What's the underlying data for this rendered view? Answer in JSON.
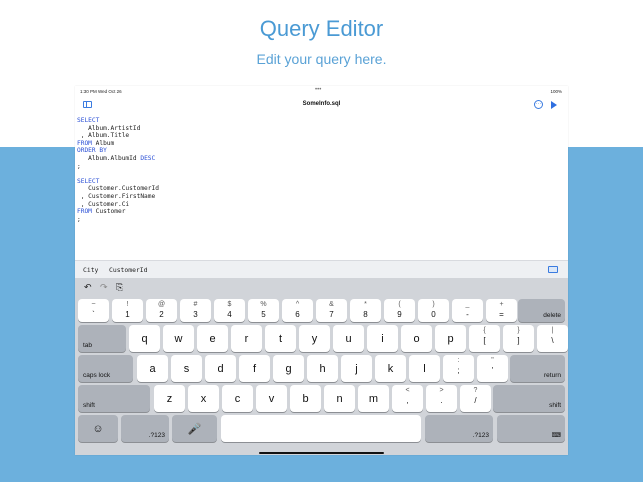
{
  "marketing": {
    "headline": "Query Editor",
    "subline": "Edit your query here."
  },
  "status_bar": {
    "time": "1:30 PM   Wed Oct 26",
    "dots": "•••",
    "battery": "100%"
  },
  "nav": {
    "title": "SomeInfo.sql",
    "sidebar_icon": "sidebar-icon",
    "more_icon": "ellipsis-circle-icon",
    "run_icon": "play-icon",
    "more_glyph": "···"
  },
  "editor": {
    "lines": [
      "SELECT",
      "   Album.ArtistId",
      " , Album.Title",
      "FROM Album",
      "ORDER BY",
      "   Album.AlbumId DESC",
      ";",
      "",
      "SELECT",
      "   Customer.CustomerId",
      " , Customer.FirstName",
      " , Customer.Ci",
      "FROM Customer",
      ";"
    ],
    "accent_color": "#2a4fd6"
  },
  "suggestions": {
    "items": [
      "City",
      "CustomerId"
    ]
  },
  "keyboard": {
    "toolbar": {
      "undo": "↶",
      "redo": "↷",
      "paste": "⎘"
    },
    "row1": [
      {
        "top": "~",
        "bot": "`"
      },
      {
        "top": "!",
        "bot": "1"
      },
      {
        "top": "@",
        "bot": "2"
      },
      {
        "top": "#",
        "bot": "3"
      },
      {
        "top": "$",
        "bot": "4"
      },
      {
        "top": "%",
        "bot": "5"
      },
      {
        "top": "^",
        "bot": "6"
      },
      {
        "top": "&",
        "bot": "7"
      },
      {
        "top": "*",
        "bot": "8"
      },
      {
        "top": "(",
        "bot": "9"
      },
      {
        "top": ")",
        "bot": "0"
      },
      {
        "top": "_",
        "bot": "-"
      },
      {
        "top": "+",
        "bot": "="
      }
    ],
    "delete": "delete",
    "tab": "tab",
    "row2": [
      "q",
      "w",
      "e",
      "r",
      "t",
      "y",
      "u",
      "i",
      "o",
      "p"
    ],
    "row2_extra": [
      {
        "top": "{",
        "bot": "["
      },
      {
        "top": "}",
        "bot": "]"
      },
      {
        "top": "|",
        "bot": "\\"
      }
    ],
    "caps_lock": "caps lock",
    "row3": [
      "a",
      "s",
      "d",
      "f",
      "g",
      "h",
      "j",
      "k",
      "l"
    ],
    "row3_extra": [
      {
        "top": ":",
        "bot": ";"
      },
      {
        "top": "\"",
        "bot": "'"
      }
    ],
    "return": "return",
    "shift_left": "shift",
    "row4": [
      "z",
      "x",
      "c",
      "v",
      "b",
      "n",
      "m"
    ],
    "row4_extra": [
      {
        "top": "<",
        "bot": ","
      },
      {
        "top": ">",
        "bot": "."
      },
      {
        "top": "?",
        "bot": "/"
      }
    ],
    "shift_right": "shift",
    "emoji": "☺",
    "numbers_left": ".?123",
    "mic": "🎤",
    "space": "",
    "numbers_right": ".?123",
    "dismiss": "⌨"
  }
}
